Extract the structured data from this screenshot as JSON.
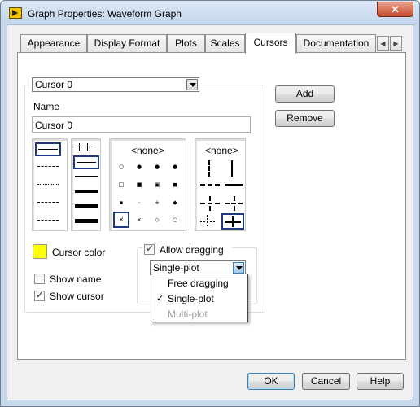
{
  "window": {
    "title": "Graph Properties: Waveform Graph",
    "close_label": "✕"
  },
  "tabs": [
    {
      "label": "Appearance"
    },
    {
      "label": "Display Format"
    },
    {
      "label": "Plots"
    },
    {
      "label": "Scales"
    },
    {
      "label": "Cursors",
      "active": true
    },
    {
      "label": "Documentation"
    }
  ],
  "tab_scroll": {
    "left": "◀",
    "right": "▶"
  },
  "cursor_select": {
    "value": "Cursor 0"
  },
  "buttons": {
    "add": "Add",
    "remove": "Remove",
    "ok": "OK",
    "cancel": "Cancel",
    "help": "Help"
  },
  "name_section": {
    "label": "Name",
    "value": "Cursor 0"
  },
  "palettes": {
    "point_none_label": "<none>",
    "line_none_label": "<none>"
  },
  "cursor_color": {
    "label": "Cursor color",
    "color": "#ffff00"
  },
  "show_name": {
    "label": "Show name",
    "checked": false
  },
  "show_cursor": {
    "label": "Show cursor",
    "checked": true
  },
  "allow_dragging": {
    "label": "Allow dragging",
    "checked": true
  },
  "drag_mode_select": {
    "value": "Single-plot"
  },
  "drag_mode_menu": {
    "items": [
      {
        "label": "Free dragging",
        "selected": false,
        "enabled": true
      },
      {
        "label": "Single-plot",
        "selected": true,
        "enabled": true
      },
      {
        "label": "Multi-plot",
        "selected": false,
        "enabled": false
      }
    ],
    "check_mark": "✓"
  }
}
